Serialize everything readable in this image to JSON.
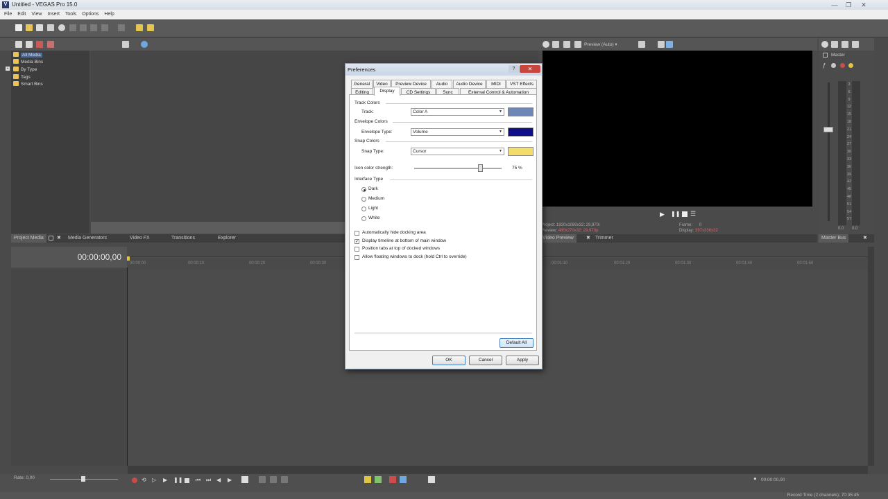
{
  "window": {
    "title": "Untitled - VEGAS Pro 15.0",
    "logo": "V"
  },
  "menu": [
    "File",
    "Edit",
    "View",
    "Insert",
    "Tools",
    "Options",
    "Help"
  ],
  "explorer_tree": [
    {
      "label": "All Media",
      "selected": true
    },
    {
      "label": "Media Bins"
    },
    {
      "label": "By Type",
      "expandable": true
    },
    {
      "label": "Tags"
    },
    {
      "label": "Smart Bins"
    }
  ],
  "preview_toolbar": {
    "mode_label": "Preview (Auto)"
  },
  "preview_info": {
    "project_label": "Project:",
    "project_value": "1920x1080x32; 29,970i",
    "preview_label": "Preview:",
    "preview_value": "480x270x32; 29,970p",
    "frame_label": "Frame:",
    "frame_value": "0",
    "display_label": "Display:",
    "display_value": "397x336x32"
  },
  "master": {
    "label": "Master",
    "left_level": "0.0",
    "right_level": "0.0",
    "scale": [
      "3",
      "6",
      "9",
      "12",
      "15",
      "18",
      "21",
      "24",
      "27",
      "30",
      "33",
      "36",
      "39",
      "42",
      "45",
      "48",
      "51",
      "54",
      "57"
    ]
  },
  "left_tabs": [
    "Project Media",
    "Media Generators",
    "Video FX",
    "Transitions",
    "Explorer"
  ],
  "right_tabs": [
    "Video Preview",
    "Trimmer"
  ],
  "master_tab": "Master Bus",
  "timecode": "00:00:00,00",
  "ruler_marks": [
    "00:00:00",
    "00:00:10",
    "00:00:20",
    "00:00:30",
    "00:01:10",
    "00:01:20",
    "00:01:30",
    "00:01:40",
    "00:01:50"
  ],
  "rate_label": "Rate: 0,00",
  "status": {
    "cursor_time": "00:00:00,00",
    "record_time": "Record Time (2 channels): 70:35:45"
  },
  "dialog": {
    "title": "Preferences",
    "help": "?",
    "close": "✕",
    "tabs_row1": [
      "General",
      "Video",
      "Preview Device",
      "Audio",
      "Audio Device",
      "MIDI",
      "VST Effects"
    ],
    "tabs_row2": [
      "Editing",
      "Display",
      "CD Settings",
      "Sync",
      "External Control & Automation"
    ],
    "active_tab": "Display",
    "track_colors": {
      "group": "Track Colors",
      "label": "Track:",
      "value": "Color A",
      "color": "#6f87b5"
    },
    "envelope_colors": {
      "group": "Envelope Colors",
      "label": "Envelope Type:",
      "value": "Volume",
      "color": "#0f0f8c"
    },
    "snap_colors": {
      "group": "Snap Colors",
      "label": "Snap Type:",
      "value": "Cursor",
      "color": "#f3dc6a"
    },
    "icon_strength": {
      "label": "Icon color strength:",
      "value": "75 %",
      "percent": 75
    },
    "interface_type": {
      "group": "Interface Type",
      "options": [
        "Dark",
        "Medium",
        "Light",
        "White"
      ],
      "selected": "Dark"
    },
    "checkboxes": [
      {
        "label": "Automatically hide docking area",
        "checked": false
      },
      {
        "label": "Display timeline at bottom of main window",
        "checked": true
      },
      {
        "label": "Position tabs at top of docked windows",
        "checked": false
      },
      {
        "label": "Allow floating windows to dock (hold Ctrl to override)",
        "checked": false
      }
    ],
    "default_all": "Default All",
    "ok": "OK",
    "cancel": "Cancel",
    "apply": "Apply"
  }
}
